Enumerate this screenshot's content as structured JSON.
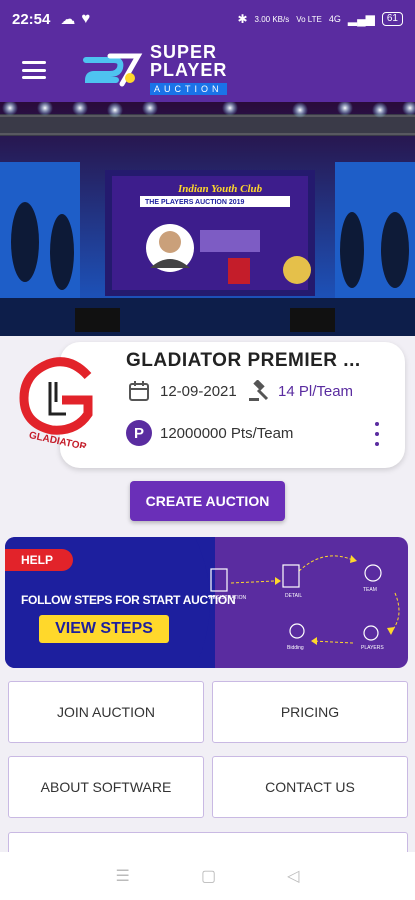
{
  "status_bar": {
    "time": "22:54",
    "network_speed": "3.00 KB/s",
    "network_type": "Vo LTE",
    "signal_label": "4G",
    "battery": "61"
  },
  "app": {
    "logo_line1": "SUPER",
    "logo_line2": "PLAYER",
    "logo_line3": "AUCTION"
  },
  "banner": {
    "headline": "Indian Youth Club",
    "subhead": "THE PLAYERS AUCTION 2019"
  },
  "auction": {
    "title": "GLADIATOR PREMIER ...",
    "logo_text": "GLADIATOR",
    "date": "12-09-2021",
    "players_per_team": "14 Pl/Team",
    "points_badge": "P",
    "points": "12000000 Pts/Team"
  },
  "actions": {
    "create_auction": "CREATE AUCTION"
  },
  "help": {
    "tag": "HELP",
    "follow_text": "FOLLOW STEPS FOR START AUCTION",
    "view_steps": "VIEW STEPS",
    "steps": [
      "REGISTRATION",
      "DETAIL",
      "TEAM",
      "PLAYERS",
      "Bidding"
    ]
  },
  "menu": {
    "join": "JOIN AUCTION",
    "pricing": "PRICING",
    "about": "ABOUT SOFTWARE",
    "contact": "CONTACT US"
  },
  "colors": {
    "primary": "#5a2ca0",
    "button": "#6a2fb8",
    "help_blue": "#1d1f9e",
    "help_yellow": "#ffd82b",
    "help_red": "#e2232a"
  }
}
